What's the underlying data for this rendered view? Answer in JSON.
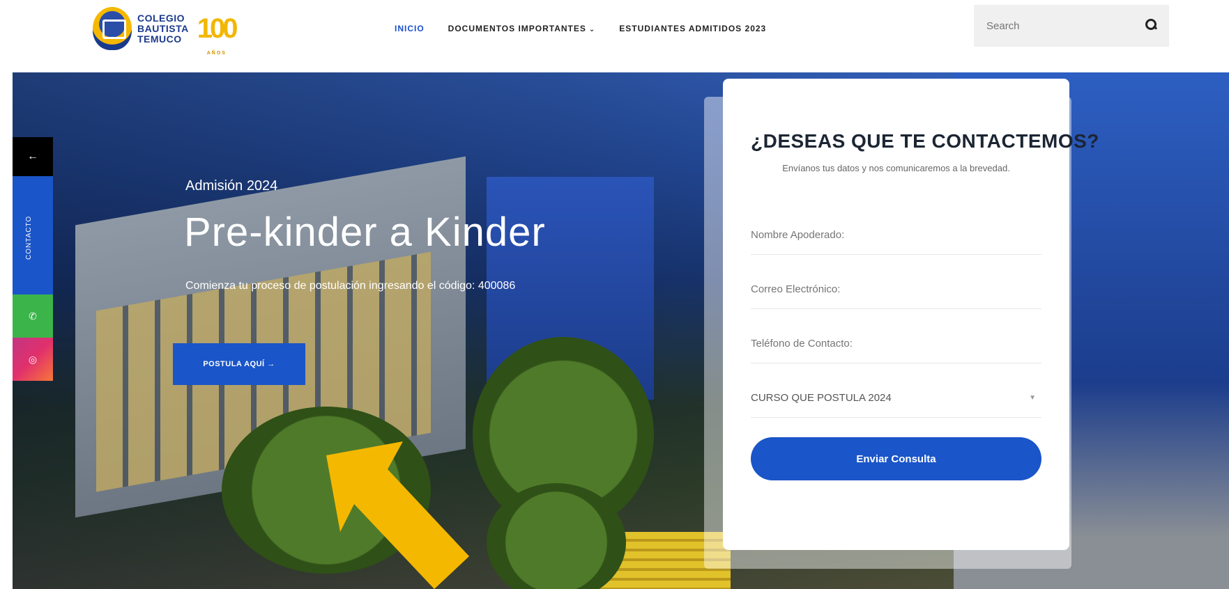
{
  "header": {
    "logo_lines": [
      "COLEGIO",
      "BAUTISTA",
      "TEMUCO"
    ],
    "anniversary": "100",
    "anniversary_sub": "AÑOS",
    "nav": [
      {
        "label": "INICIO",
        "active": true
      },
      {
        "label": "DOCUMENTOS IMPORTANTES",
        "has_dropdown": true
      },
      {
        "label": "ESTUDIANTES ADMITIDOS 2023"
      }
    ],
    "search_placeholder": "Search",
    "search_icon": "search-icon"
  },
  "hero": {
    "subtitle": "Admisión 2024",
    "title": "Pre-kinder a Kinder",
    "description": "Comienza tu proceso de postulación ingresando el código: 400086",
    "cta_label": "POSTULA AQUÍ →"
  },
  "side_tab": {
    "back_icon": "←",
    "contact_label": "CONTACTO",
    "whatsapp_icon": "whatsapp-icon",
    "instagram_icon": "instagram-icon"
  },
  "form": {
    "title": "¿DESEAS QUE TE CONTACTEMOS?",
    "description": "Envíanos tus datos y nos comunicaremos a la brevedad.",
    "fields": [
      {
        "placeholder": "Nombre Apoderado:"
      },
      {
        "placeholder": "Correo Electrónico:"
      },
      {
        "placeholder": "Teléfono de Contacto:"
      }
    ],
    "select_value": "CURSO QUE POSTULA 2024",
    "submit_label": "Enviar Consulta"
  },
  "colors": {
    "accent": "#1a55c9",
    "highlight_arrow": "#f5b800"
  }
}
